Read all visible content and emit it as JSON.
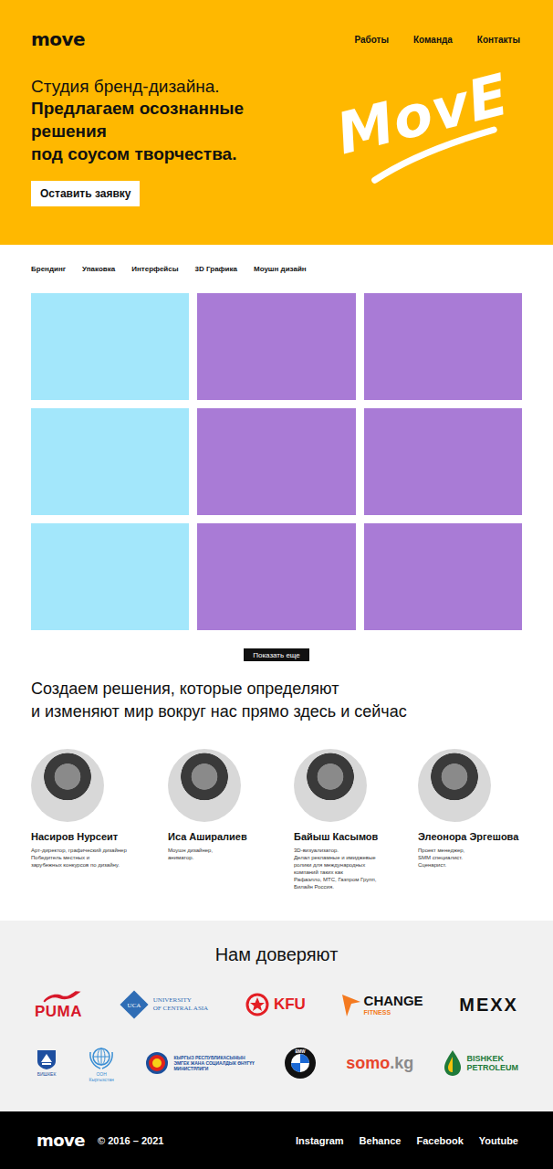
{
  "header": {
    "logo": "move",
    "nav": [
      "Работы",
      "Команда",
      "Контакты"
    ],
    "lead": "Студия бренд-дизайна.",
    "headline": [
      "Предлагаем осознанные",
      "решения",
      "под соусом творчества."
    ],
    "button": "Оставить заявку",
    "mark": "MovE"
  },
  "filters": [
    {
      "label": "Брендинг",
      "selected": false
    },
    {
      "label": "Упаковка",
      "selected": false
    },
    {
      "label": "Интерфейсы",
      "selected": false
    },
    {
      "label": "3D Графика",
      "selected": false
    },
    {
      "label": "Моушн дизайн",
      "selected": false
    }
  ],
  "projects": [
    {
      "color": "#a3e7fb"
    },
    {
      "color": "#a97bd6"
    },
    {
      "color": "#a97bd6"
    },
    {
      "color": "#a3e7fb"
    },
    {
      "color": "#a97bd6"
    },
    {
      "color": "#a97bd6"
    },
    {
      "color": "#a3e7fb"
    },
    {
      "color": "#a97bd6"
    },
    {
      "color": "#a97bd6"
    }
  ],
  "more_button": "Показать еще",
  "mission": [
    "Создаем решения, которые определяют",
    "и изменяют мир вокруг нас прямо здесь и сейчас"
  ],
  "team": [
    {
      "name": "Насиров Нурсеит",
      "bio": [
        "Арт-директор, графический дизайнер",
        "Победитель местных и",
        "зарубежных конкурсов по дизайну."
      ]
    },
    {
      "name": "Иса Аширалиев",
      "bio": [
        "Моушн дизайнер,",
        "аниматор."
      ]
    },
    {
      "name": "Байыш Касымов",
      "bio": [
        "3D-визуализатор.",
        "Делал рекламные и имиджевые",
        "ролики для международных",
        "компаний таких как",
        "Рафаэлло, МТС, Газпром Групп,",
        "Билайн Россия."
      ]
    },
    {
      "name": "Элеонора Эргешова",
      "bio": [
        "Проект менеджер,",
        "SMM специалист.",
        "Сценарист."
      ]
    }
  ],
  "partners": {
    "title": "Нам доверяют",
    "rows": [
      [
        {
          "kind": "cat",
          "lines": [
            "PUMA"
          ],
          "color": "#d7182a"
        },
        {
          "kind": "diamond",
          "mark": "UCA",
          "lines": [
            "UNIVERSITY",
            "OF CENTRAL ASIA"
          ],
          "color": "#2f6db5"
        },
        {
          "kind": "ring",
          "lines": [
            "KFU"
          ],
          "color": "#e31e24"
        },
        {
          "kind": "arrow",
          "lines": [
            "CHANGE",
            "FITNESS"
          ],
          "color": "#f47a20"
        },
        {
          "kind": "plain",
          "lines": [
            "MEXX"
          ],
          "color": "#111111"
        }
      ],
      [
        {
          "kind": "shield",
          "lines": [
            "БИШКЕК"
          ],
          "color": "#1e4fa0"
        },
        {
          "kind": "globe",
          "lines": [
            "ООН",
            "Кыргызстан"
          ],
          "color": "#3b8fd4"
        },
        {
          "kind": "seal",
          "lines": [
            "КЫРГЫЗ РЕСПУБЛИКАСЫНЫН",
            "ЭМГЕК ЖАНА СОЦИАЛДЫК ӨНҮГҮҮ",
            "МИНИСТРЛИГИ"
          ],
          "color": "#1b4f9c"
        },
        {
          "kind": "bmw",
          "mark": "BMW",
          "lines": [],
          "color": "#1c69d4"
        },
        {
          "kind": "somo",
          "lines": [
            "somo",
            ".kg"
          ],
          "color": "#e8452c"
        },
        {
          "kind": "drop",
          "lines": [
            "BISHKEK",
            "PETROLEUM"
          ],
          "color": "#1f7a3a"
        }
      ]
    ]
  },
  "footer": {
    "logo": "move",
    "copyright": "© 2016 – 2021",
    "links": [
      "Instagram",
      "Behance",
      "Facebook",
      "Youtube"
    ]
  }
}
